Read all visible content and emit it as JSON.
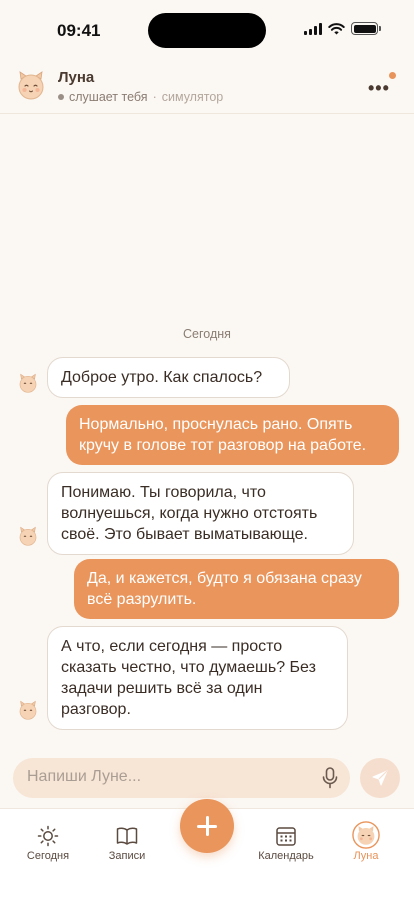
{
  "status_bar": {
    "time": "09:41"
  },
  "header": {
    "name": "Луна",
    "status": "слушает тебя",
    "separator": "·",
    "extra": "симулятор"
  },
  "chat": {
    "day_label": "Сегодня",
    "messages": [
      {
        "from": "luna",
        "text": "Доброе утро. Как спалось?"
      },
      {
        "from": "user",
        "text": "Нормально, проснулась рано. Опять кручу в голове тот разговор на работе."
      },
      {
        "from": "luna",
        "text": "Понимаю. Ты говорила, что волнуешься, когда нужно отстоять своё. Это бывает выматывающе."
      },
      {
        "from": "user",
        "text": "Да, и кажется, будто я обязана сразу всё разрулить."
      },
      {
        "from": "luna",
        "text": "А что, если сегодня — просто сказать честно, что думаешь? Без задачи решить всё за один разговор."
      }
    ]
  },
  "composer": {
    "placeholder": "Напиши Луне..."
  },
  "tabs": [
    {
      "label": "Сегодня",
      "icon": "sun-icon"
    },
    {
      "label": "Записи",
      "icon": "book-icon"
    },
    {
      "label": "Календарь",
      "icon": "calendar-icon"
    },
    {
      "label": "Луна",
      "icon": "luna-avatar-icon",
      "active": true
    }
  ],
  "colors": {
    "accent": "#e9955c",
    "background": "#fbf7f2",
    "bubble_in": "#ffffff",
    "bubble_out": "#e9955c",
    "composer_bg": "#f7e5d6"
  }
}
